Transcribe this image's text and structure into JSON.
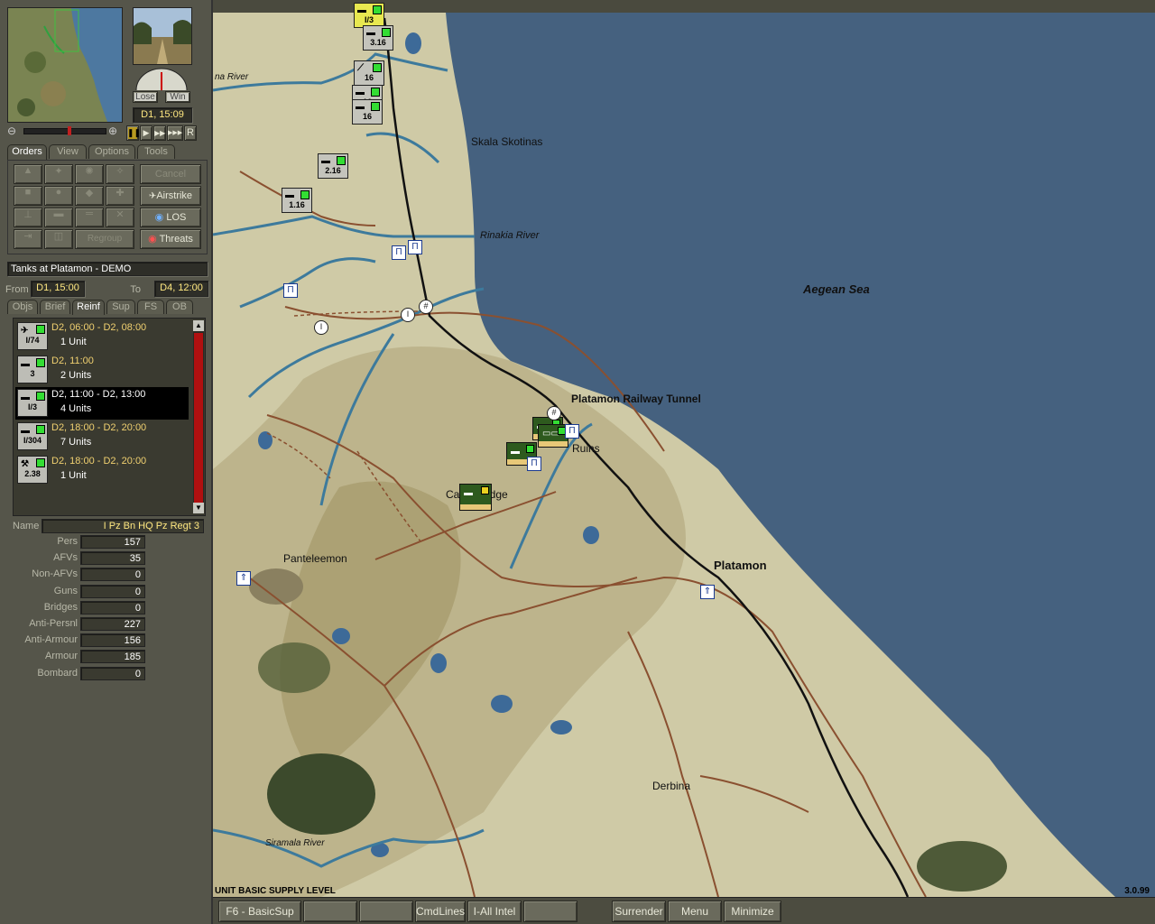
{
  "clock": "D1, 15:09",
  "score_labels": {
    "lose": "Lose",
    "win": "Win"
  },
  "replay_r": "R",
  "tabs_top": [
    "Orders",
    "View",
    "Options",
    "Tools"
  ],
  "orders": {
    "cancel": "Cancel",
    "airstrike": "Airstrike",
    "los": "LOS",
    "threats": "Threats",
    "regroup": "Regroup"
  },
  "scenario": {
    "title": "Tanks at Platamon - DEMO",
    "from_label": "From",
    "from": "D1, 15:00",
    "to_label": "To",
    "to": "D4, 12:00"
  },
  "tabs_info": [
    "Objs",
    "Brief",
    "Reinf",
    "Sup",
    "FS",
    "OB"
  ],
  "reinforcements": [
    {
      "time": "D2, 06:00 - D2, 08:00",
      "units": "1 Unit",
      "counter": "I/74",
      "icon": "plane"
    },
    {
      "time": "D2, 11:00",
      "units": "2 Units",
      "counter": "3",
      "icon": "tank"
    },
    {
      "time": "D2, 11:00 - D2, 13:00",
      "units": "4 Units",
      "counter": "I/3",
      "icon": "tank",
      "selected": true
    },
    {
      "time": "D2, 18:00 - D2, 20:00",
      "units": "7 Units",
      "counter": "I/304",
      "icon": "truck"
    },
    {
      "time": "D2, 18:00 - D2, 20:00",
      "units": "1 Unit",
      "counter": "2.38",
      "icon": "tools"
    }
  ],
  "unit": {
    "name_label": "Name",
    "name": "I Pz Bn HQ Pz Regt 3",
    "stats": [
      {
        "label": "Pers",
        "value": "157"
      },
      {
        "label": "AFVs",
        "value": "35"
      },
      {
        "label": "Non-AFVs",
        "value": "0"
      },
      {
        "label": "Guns",
        "value": "0"
      },
      {
        "label": "Bridges",
        "value": "0"
      },
      {
        "label": "Anti-Persnl",
        "value": "227"
      },
      {
        "label": "Anti-Armour",
        "value": "156"
      },
      {
        "label": "Armour",
        "value": "185"
      },
      {
        "label": "Bombard",
        "value": "0"
      }
    ]
  },
  "map_labels": {
    "river1": "na River",
    "skala": "Skala Skotinas",
    "rinakia": "Rinakia River",
    "aegean": "Aegean Sea",
    "tunnel": "Platamon Railway Tunnel",
    "ruins": "Ruins",
    "castle": "Castle Ridge",
    "panteleemon": "Panteleemon",
    "platamon": "Platamon",
    "derbina": "Derbina",
    "siramala": "Siramala River"
  },
  "map_counters": [
    "I/3",
    "3.16",
    "16",
    "16",
    "16",
    "2.16",
    "1.16"
  ],
  "status_text": "UNIT BASIC SUPPLY LEVEL",
  "version": "3.0.99",
  "bottom": {
    "f6": "F6 - BasicSup",
    "cmdlines": "CmdLines",
    "intel": "I-All Intel",
    "surrender": "Surrender",
    "menu": "Menu",
    "minimize": "Minimize"
  },
  "colors": {
    "sea": "#45617f",
    "land": "#cfcaa6",
    "panel": "#55554a",
    "river": "#3d7a9c",
    "road": "#8a5030"
  }
}
